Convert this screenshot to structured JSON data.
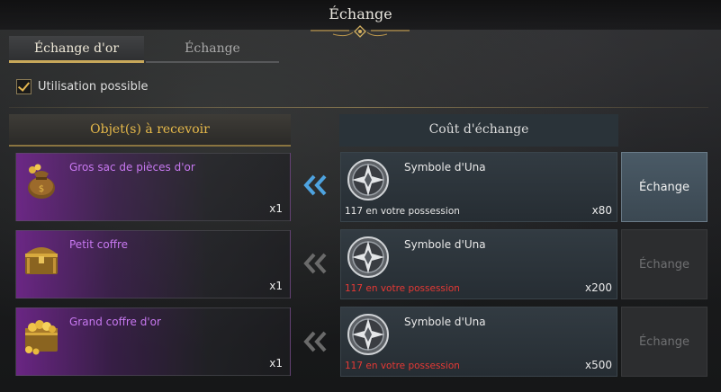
{
  "window": {
    "title": "Échange"
  },
  "tabs": [
    {
      "label": "Échange d'or",
      "active": true
    },
    {
      "label": "Échange",
      "active": false
    }
  ],
  "filter": {
    "label": "Utilisation possible",
    "checked": true
  },
  "columns": {
    "receive": "Objet(s) à recevoir",
    "cost": "Coût d'échange"
  },
  "rows": [
    {
      "item_name": "Gros sac de pièces d'or",
      "item_icon": "gold-coin-bag-icon",
      "item_qty": "x1",
      "cost_name": "Symbole d'Una",
      "cost_icon": "una-symbol-icon",
      "possession": "117 en votre possession",
      "possession_color": "#e6e6e6",
      "cost_qty": "x80",
      "button": "Échange",
      "enabled": true
    },
    {
      "item_name": "Petit coffre",
      "item_icon": "small-chest-icon",
      "item_qty": "x1",
      "cost_name": "Symbole d'Una",
      "cost_icon": "una-symbol-icon",
      "possession": "117 en votre possession",
      "possession_color": "#e53935",
      "cost_qty": "x200",
      "button": "Échange",
      "enabled": false
    },
    {
      "item_name": "Grand coffre d'or",
      "item_icon": "large-gold-chest-icon",
      "item_qty": "x1",
      "cost_name": "Symbole d'Una",
      "cost_icon": "una-symbol-icon",
      "possession": "117 en votre possession",
      "possession_color": "#e53935",
      "cost_qty": "x500",
      "button": "Échange",
      "enabled": false
    }
  ],
  "colors": {
    "accent_gold": "#c8a85a",
    "item_purple": "#c778f0",
    "arrow_active": "#4ea3e0",
    "arrow_inactive": "#6a6a6a"
  }
}
